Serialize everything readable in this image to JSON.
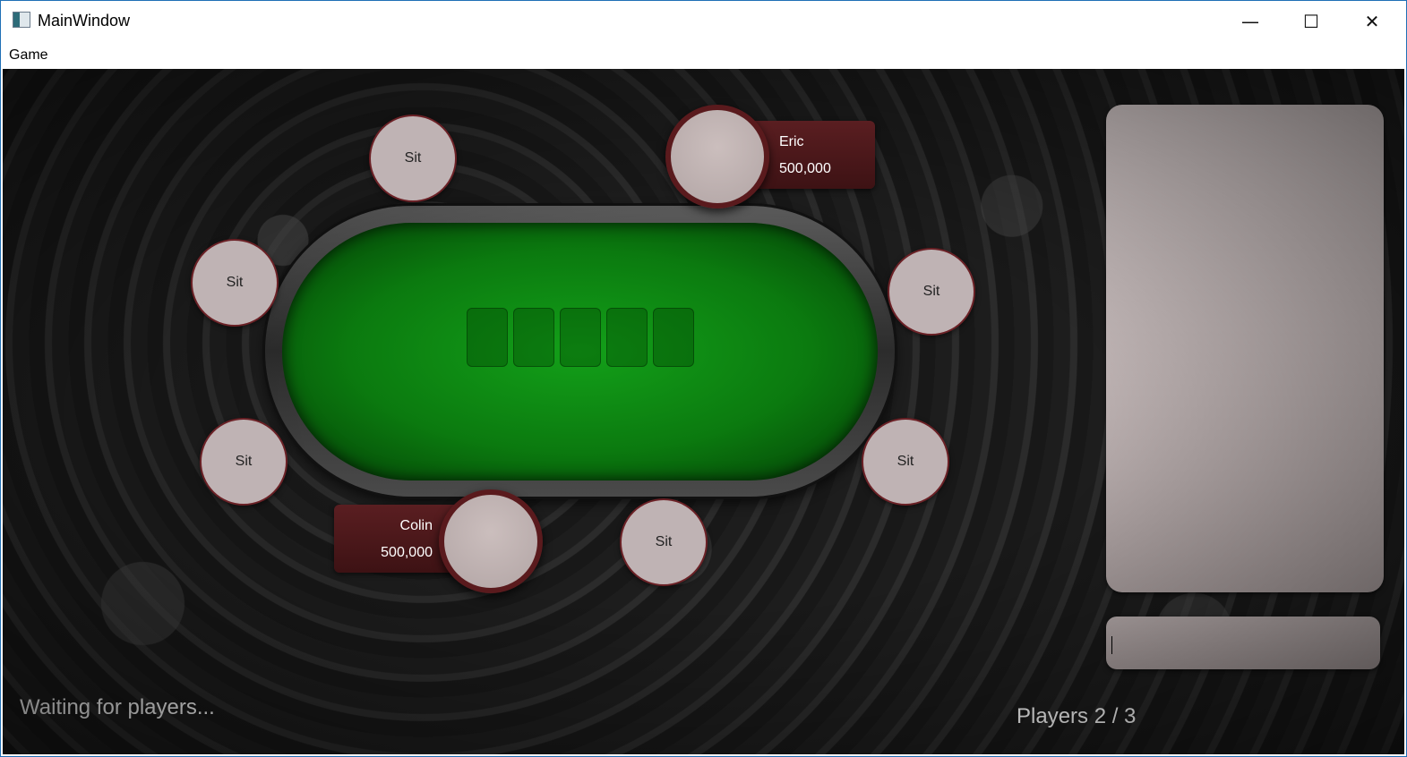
{
  "window": {
    "title": "MainWindow",
    "minimize_glyph": "—",
    "maximize_glyph": "☐",
    "close_glyph": "✕"
  },
  "menu": {
    "items": [
      "Game"
    ]
  },
  "seats": {
    "sit_label": "Sit"
  },
  "players": [
    {
      "name": "Eric",
      "chips": "500,000"
    },
    {
      "name": "Colin",
      "chips": "500,000"
    }
  ],
  "chat": {
    "input_value": "",
    "input_placeholder": ""
  },
  "status": {
    "message": "Waiting for players...",
    "players_count": "Players 2 / 3"
  },
  "colors": {
    "felt": "#0b7a0f",
    "seat": "#bfb3b4",
    "seat_border": "#6b2126",
    "plate": "#5a1e21",
    "chat_panel": "#d6cbcb"
  }
}
